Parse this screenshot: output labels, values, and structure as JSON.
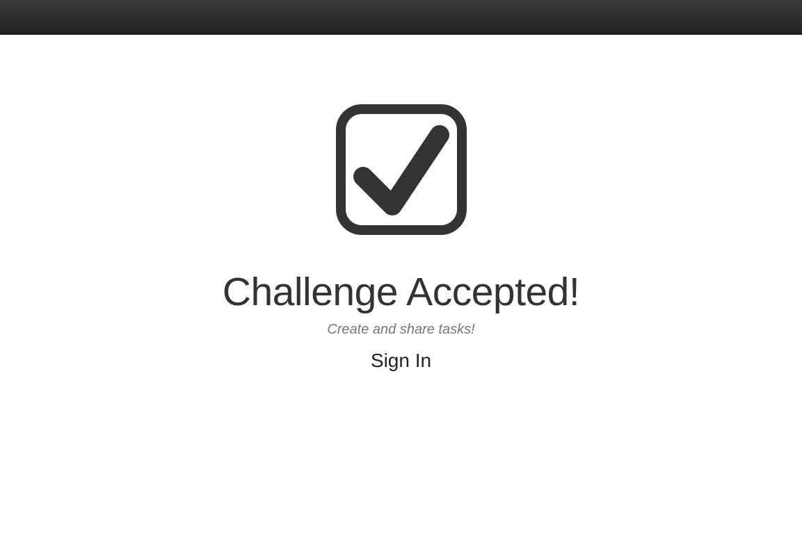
{
  "navbar": {
    "color": "#2d2d2d"
  },
  "hero": {
    "icon": "checkbox-checked-icon",
    "title": "Challenge Accepted!",
    "tagline": "Create and share tasks!",
    "signin_label": "Sign In",
    "text_color": "#333333",
    "muted_color": "#777777"
  }
}
